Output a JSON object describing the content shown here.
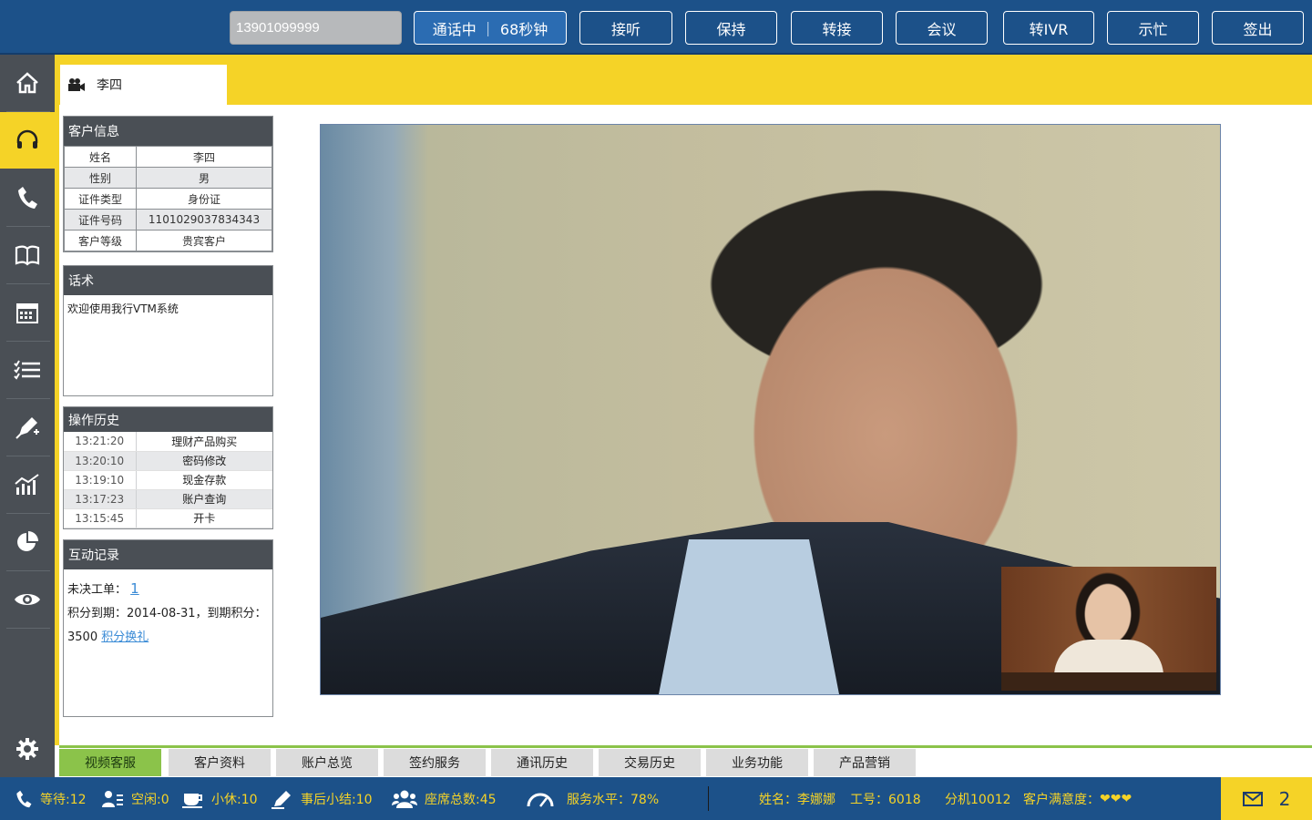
{
  "topbar": {
    "phone_value": "13901099999",
    "call_status": "通话中 ｜ 68秒钟",
    "buttons": [
      "接听",
      "保持",
      "转接",
      "会议",
      "转IVR",
      "示忙",
      "签出"
    ]
  },
  "sidebar": {
    "items": [
      "home-icon",
      "headset-icon",
      "phone-icon",
      "book-icon",
      "calendar-icon",
      "checklist-icon",
      "pen-icon",
      "chart-icon",
      "pie-icon",
      "eye-icon"
    ],
    "active": "headset-icon",
    "settings": "gear-icon"
  },
  "session_tab": {
    "icon": "video-camera-icon",
    "name": "李四"
  },
  "customer_info": {
    "title": "客户信息",
    "rows": [
      {
        "label": "姓名",
        "value": "李四"
      },
      {
        "label": "性别",
        "value": "男"
      },
      {
        "label": "证件类型",
        "value": "身份证"
      },
      {
        "label": "证件号码",
        "value": "1101029037834343"
      },
      {
        "label": "客户等级",
        "value": "贵宾客户"
      }
    ]
  },
  "script": {
    "title": "话术",
    "text": "欢迎使用我行VTM系统"
  },
  "history": {
    "title": "操作历史",
    "rows": [
      {
        "time": "13:21:20",
        "action": "理财产品购买"
      },
      {
        "time": "13:20:10",
        "action": "密码修改"
      },
      {
        "time": "13:19:10",
        "action": "现金存款"
      },
      {
        "time": "13:17:23",
        "action": "账户查询"
      },
      {
        "time": "13:15:45",
        "action": "开卡"
      }
    ]
  },
  "interaction": {
    "title": "互动记录",
    "pending_label": "未决工单：",
    "pending_count": "1",
    "points_line": "积分到期：2014-08-31，到期积分：",
    "points_value": "3500",
    "redeem_link": "积分换礼"
  },
  "bottom_tabs": [
    "视频客服",
    "客户资料",
    "账户总览",
    "签约服务",
    "通讯历史",
    "交易历史",
    "业务功能",
    "产品营销"
  ],
  "bottom_tabs_active": "视频客服",
  "status": {
    "waiting": "等待:12",
    "idle": "空闲:0",
    "break": "小休:10",
    "after_call": "事后小结:10",
    "total_seats": "座席总数:45",
    "service_level": "服务水平：78%",
    "agent_name": "姓名：李娜娜",
    "agent_id": "工号：6018",
    "extension": "分机10012",
    "satisfaction_label": "客户满意度：",
    "satisfaction_hearts": "❤❤❤",
    "mail_count": "2"
  },
  "colors": {
    "brand_blue": "#1c5189",
    "accent_yellow": "#f5d327",
    "sidebar_gray": "#4a4f55",
    "active_tab_green": "#8bc34a"
  }
}
